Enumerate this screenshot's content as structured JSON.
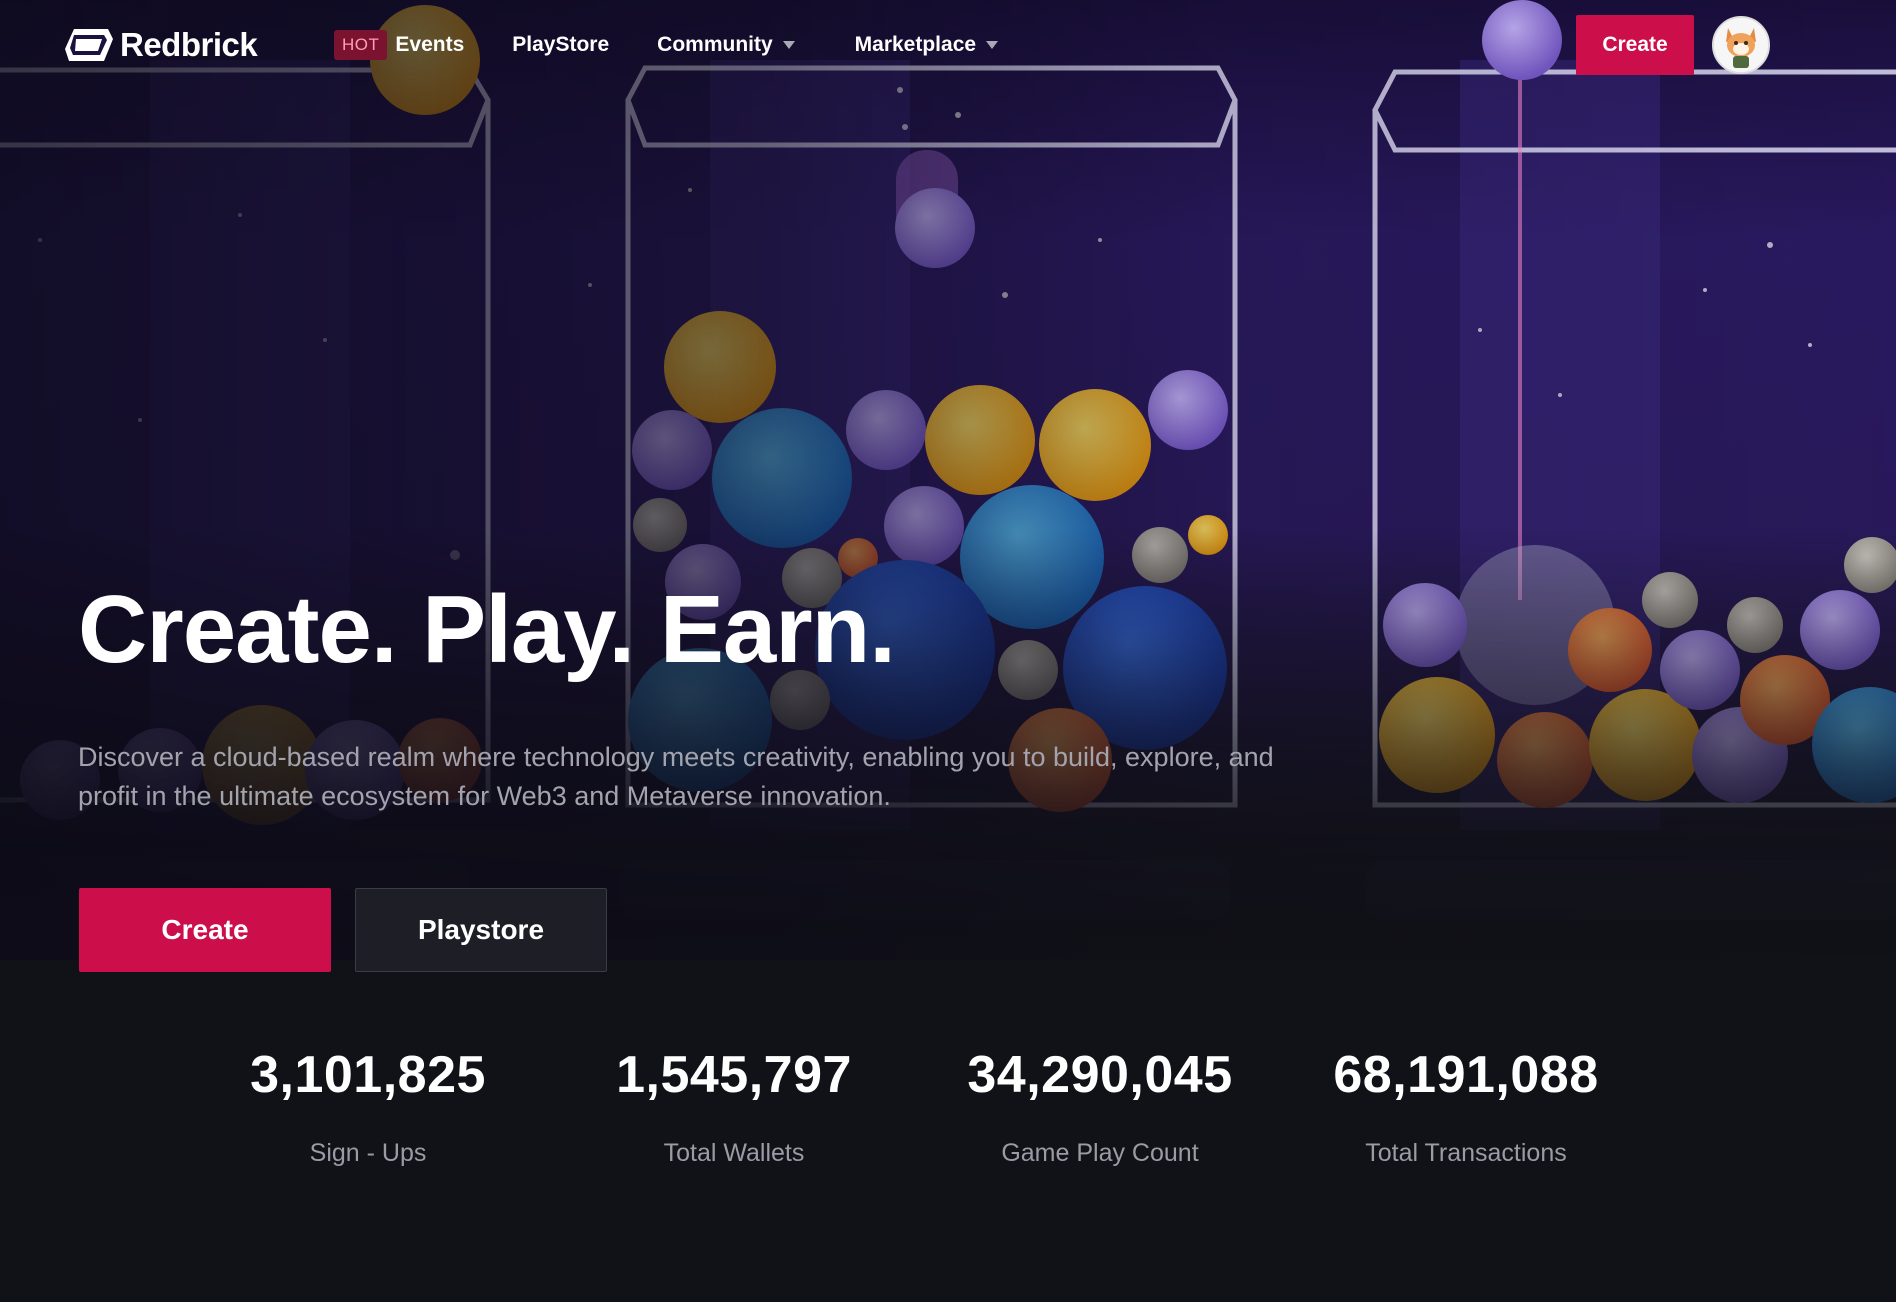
{
  "header": {
    "logo_text": "Redbrick",
    "nav": [
      {
        "badge": "HOT",
        "label": "Events",
        "has_dropdown": false
      },
      {
        "label": "PlayStore",
        "has_dropdown": false
      },
      {
        "label": "Community",
        "has_dropdown": true
      },
      {
        "label": "Marketplace",
        "has_dropdown": true
      }
    ],
    "create_label": "Create",
    "avatar_icon": "fox-avatar-icon"
  },
  "hero": {
    "title": "Create. Play. Earn.",
    "description": "Discover a cloud-based realm where technology meets creativity, enabling you to build, explore, and profit in the ultimate ecosystem for Web3 and Metaverse innovation.",
    "primary_button": "Create",
    "secondary_button": "Playstore"
  },
  "stats": [
    {
      "value": "3,101,825",
      "label": "Sign - Ups"
    },
    {
      "value": "1,545,797",
      "label": "Total Wallets"
    },
    {
      "value": "34,290,045",
      "label": "Game Play Count"
    },
    {
      "value": "68,191,088",
      "label": "Total Transactions"
    }
  ],
  "colors": {
    "accent": "#cc0e4b",
    "background": "#111217",
    "hot_badge": "#7a1230",
    "muted_text": "#9b9ba6"
  }
}
